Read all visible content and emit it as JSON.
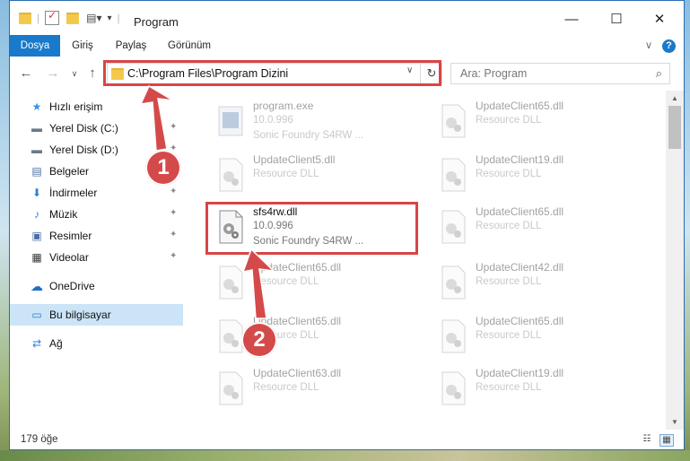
{
  "window": {
    "title": "Program",
    "minimize": "—",
    "maximize": "☐",
    "close": "✕"
  },
  "ribbon": {
    "tabs": [
      "Dosya",
      "Giriş",
      "Paylaş",
      "Görünüm"
    ],
    "expand": "∨",
    "help": "?"
  },
  "nav": {
    "back": "←",
    "forward": "→",
    "recent": "∨",
    "up": "↑",
    "address": "C:\\Program Files\\Program Dizini",
    "address_dropdown": "∨",
    "refresh": "↻",
    "search_placeholder": "Ara: Program",
    "search_icon": "⌕"
  },
  "sidebar": {
    "items": [
      {
        "label": "Hızlı erişim",
        "icon": "star-icon",
        "glyph": "★",
        "color": "#3a8ee6",
        "pinned": false
      },
      {
        "label": "Yerel Disk (C:)",
        "icon": "drive-icon",
        "glyph": "▬",
        "color": "#6b7a8a",
        "pinned": true
      },
      {
        "label": "Yerel Disk (D:)",
        "icon": "drive-icon",
        "glyph": "▬",
        "color": "#6b7a8a",
        "pinned": true
      },
      {
        "label": "Belgeler",
        "icon": "documents-icon",
        "glyph": "▤",
        "color": "#4a6fa5",
        "pinned": true
      },
      {
        "label": "İndirmeler",
        "icon": "download-icon",
        "glyph": "⬇",
        "color": "#2f7dd1",
        "pinned": true
      },
      {
        "label": "Müzik",
        "icon": "music-icon",
        "glyph": "♪",
        "color": "#2f7dd1",
        "pinned": true
      },
      {
        "label": "Resimler",
        "icon": "pictures-icon",
        "glyph": "▣",
        "color": "#4a6fa5",
        "pinned": true
      },
      {
        "label": "Videolar",
        "icon": "videos-icon",
        "glyph": "▦",
        "color": "#333333",
        "pinned": true
      },
      {
        "label": "OneDrive",
        "icon": "cloud-icon",
        "glyph": "☁",
        "color": "#1c6fc9",
        "pinned": false
      },
      {
        "label": "Bu bilgisayar",
        "icon": "computer-icon",
        "glyph": "▭",
        "color": "#2f7dd1",
        "pinned": false,
        "selected": true
      },
      {
        "label": "Ağ",
        "icon": "network-icon",
        "glyph": "⇄",
        "color": "#2f7dd1",
        "pinned": false
      }
    ],
    "pin_glyph": "📌"
  },
  "files": [
    {
      "name": "program.exe",
      "line2": "10.0.996",
      "line3": "Sonic Foundry S4RW ...",
      "kind": "exe",
      "faded": true
    },
    {
      "name": "UpdateClient65.dll",
      "line2": "Resource DLL",
      "line3": "",
      "kind": "dll",
      "faded": true
    },
    {
      "name": "UpdateClient5.dll",
      "line2": "Resource DLL",
      "line3": "",
      "kind": "dll",
      "faded": true
    },
    {
      "name": "UpdateClient19.dll",
      "line2": "Resource DLL",
      "line3": "",
      "kind": "dll",
      "faded": true
    },
    {
      "name": "sfs4rw.dll",
      "line2": "10.0.996",
      "line3": "Sonic Foundry S4RW ...",
      "kind": "dll",
      "faded": false
    },
    {
      "name": "UpdateClient65.dll",
      "line2": "Resource DLL",
      "line3": "",
      "kind": "dll",
      "faded": true
    },
    {
      "name": "UpdateClient65.dll",
      "line2": "Resource DLL",
      "line3": "",
      "kind": "dll",
      "faded": true
    },
    {
      "name": "UpdateClient42.dll",
      "line2": "Resource DLL",
      "line3": "",
      "kind": "dll",
      "faded": true
    },
    {
      "name": "UpdateClient65.dll",
      "line2": "Resource DLL",
      "line3": "",
      "kind": "dll",
      "faded": true
    },
    {
      "name": "UpdateClient65.dll",
      "line2": "Resource DLL",
      "line3": "",
      "kind": "dll",
      "faded": true
    },
    {
      "name": "UpdateClient63.dll",
      "line2": "Resource DLL",
      "line3": "",
      "kind": "dll",
      "faded": true
    },
    {
      "name": "UpdateClient19.dll",
      "line2": "Resource DLL",
      "line3": "",
      "kind": "dll",
      "faded": true
    }
  ],
  "status": {
    "count": "179 öğe",
    "details_view": "☷",
    "tiles_view": "▦"
  },
  "callouts": [
    "1",
    "2"
  ],
  "colors": {
    "accent": "#1979ca",
    "highlight": "#d94545",
    "selected": "#cce4f7"
  }
}
